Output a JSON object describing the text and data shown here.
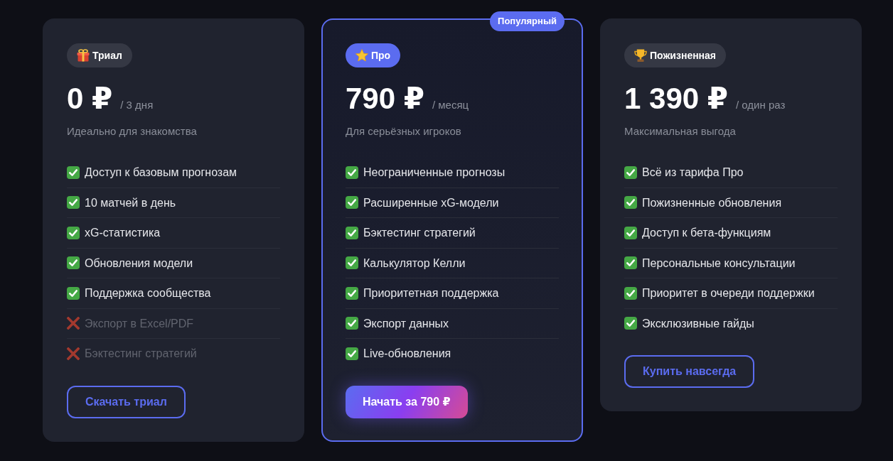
{
  "plans": [
    {
      "badge": "Триал",
      "featured": false,
      "price": "0 ₽",
      "period": "/ 3 дня",
      "tagline": "Идеально для знакомства",
      "features": [
        {
          "label": "Доступ к базовым прогнозам",
          "included": true
        },
        {
          "label": "10 матчей в день",
          "included": true
        },
        {
          "label": "xG-статистика",
          "included": true
        },
        {
          "label": "Обновления модели",
          "included": true
        },
        {
          "label": "Поддержка сообщества",
          "included": true
        },
        {
          "label": "Экспорт в Excel/PDF",
          "included": false
        },
        {
          "label": "Бэктестинг стратегий",
          "included": false
        }
      ],
      "button": {
        "label": "Скачать триал",
        "kind": "outline"
      }
    },
    {
      "badge": "Про",
      "featured": true,
      "ribbon": "Популярный",
      "price": "790 ₽",
      "period": "/ месяц",
      "tagline": "Для серьёзных игроков",
      "features": [
        {
          "label": "Неограниченные прогнозы",
          "included": true
        },
        {
          "label": "Расширенные xG-модели",
          "included": true
        },
        {
          "label": "Бэктестинг стратегий",
          "included": true
        },
        {
          "label": "Калькулятор Келли",
          "included": true
        },
        {
          "label": "Приоритетная поддержка",
          "included": true
        },
        {
          "label": "Экспорт данных",
          "included": true
        },
        {
          "label": "Live-обновления",
          "included": true
        }
      ],
      "button": {
        "label": "Начать за 790 ₽",
        "kind": "gradient"
      }
    },
    {
      "badge": "Пожизненная",
      "featured": false,
      "price": "1 390 ₽",
      "period": "/ один раз",
      "tagline": "Максимальная выгода",
      "features": [
        {
          "label": "Всё из тарифа Про",
          "included": true
        },
        {
          "label": "Пожизненные обновления",
          "included": true
        },
        {
          "label": "Доступ к бета-функциям",
          "included": true
        },
        {
          "label": "Персональные консультации",
          "included": true
        },
        {
          "label": "Приоритет в очереди поддержки",
          "included": true
        },
        {
          "label": "Эксклюзивные гайды",
          "included": true
        }
      ],
      "button": {
        "label": "Купить навсегда",
        "kind": "outline"
      }
    }
  ]
}
